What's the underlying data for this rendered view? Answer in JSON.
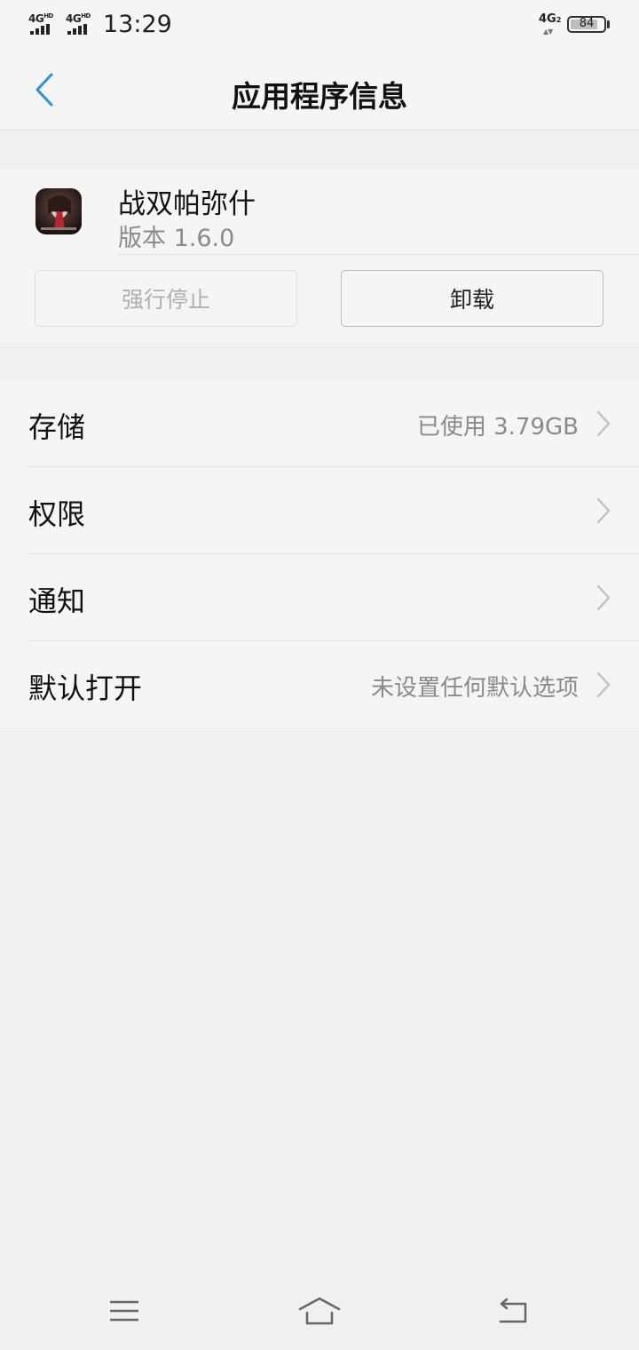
{
  "status_bar": {
    "sim1_network": "4G",
    "sim1_hd": "HD",
    "sim2_network": "4G",
    "sim2_hd": "HD",
    "time": "13:29",
    "data_network": "4G",
    "data_sim": "2",
    "battery_level": "84"
  },
  "header": {
    "title": "应用程序信息",
    "back_icon": "chevron-left-icon",
    "accent_color": "#2d8fe0"
  },
  "app": {
    "name": "战双帕弥什",
    "version": "版本 1.6.0",
    "force_stop_label": "强行停止",
    "uninstall_label": "卸载"
  },
  "settings": {
    "storage": {
      "label": "存储",
      "value": "已使用 3.79GB"
    },
    "permissions": {
      "label": "权限",
      "value": ""
    },
    "notifications": {
      "label": "通知",
      "value": ""
    },
    "default_open": {
      "label": "默认打开",
      "value": "未设置任何默认选项"
    }
  },
  "nav_bar": {
    "menu_icon": "menu-icon",
    "home_icon": "home-icon",
    "back_icon": "back-arrow-icon"
  }
}
